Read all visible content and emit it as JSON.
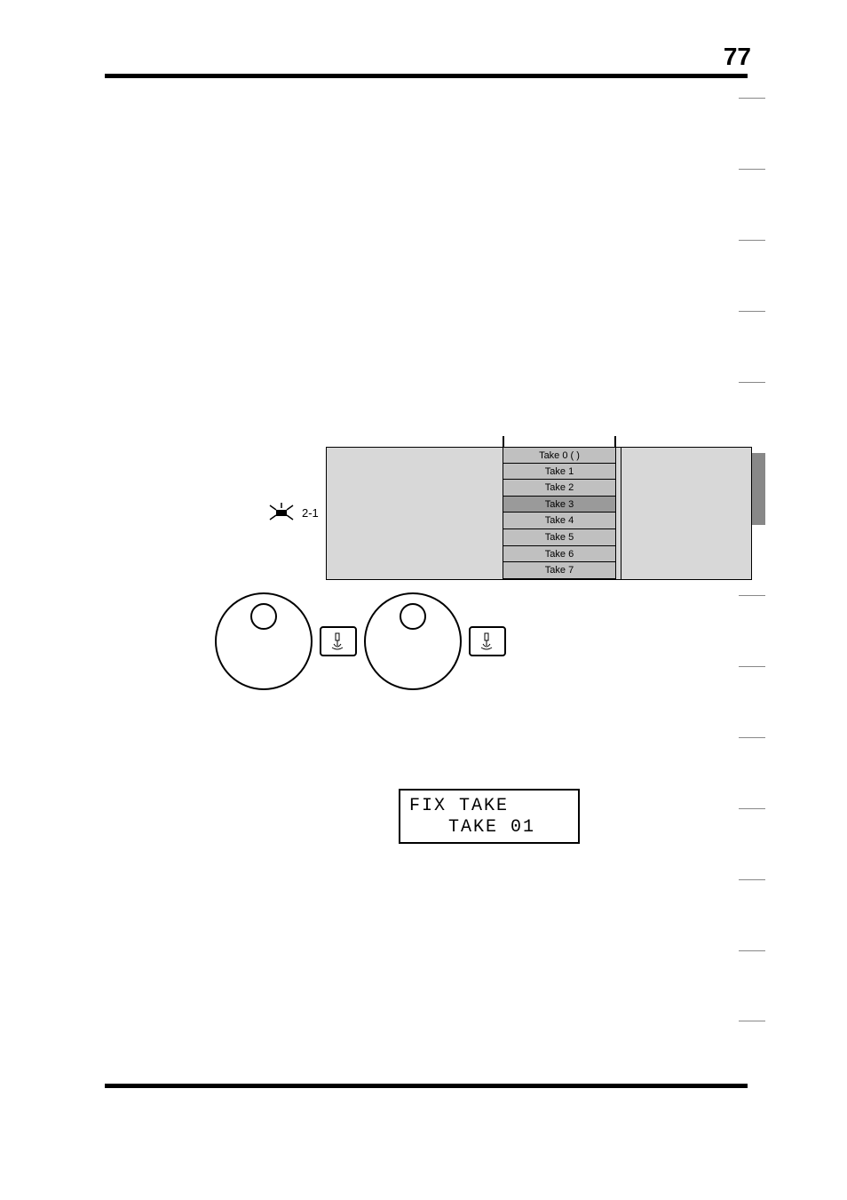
{
  "page_number": "77",
  "flasher_label": "2-1",
  "takes": [
    {
      "label": "Take 0 (           )",
      "selected": false
    },
    {
      "label": "Take 1",
      "selected": false
    },
    {
      "label": "Take 2",
      "selected": false
    },
    {
      "label": "Take 3",
      "selected": true
    },
    {
      "label": "Take 4",
      "selected": false
    },
    {
      "label": "Take 5",
      "selected": false
    },
    {
      "label": "Take 6",
      "selected": false
    },
    {
      "label": "Take 7",
      "selected": false
    }
  ],
  "lcd": {
    "line1": "FIX TAKE",
    "line2": "TAKE 01"
  },
  "side_tabs": {
    "count": 13,
    "active_index": 5
  }
}
